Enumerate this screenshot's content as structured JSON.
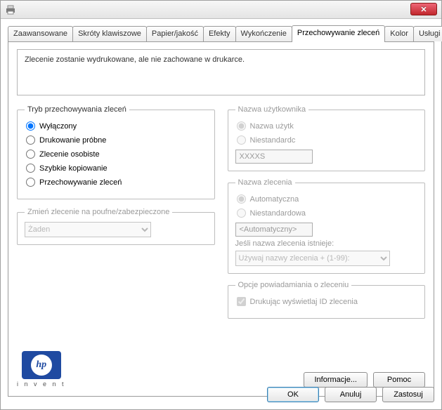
{
  "titlebar": {
    "close_glyph": "✕"
  },
  "tabs": {
    "advanced": "Zaawansowane",
    "shortcuts": "Skróty klawiszowe",
    "paper": "Papier/jakość",
    "effects": "Efekty",
    "finishing": "Wykończenie",
    "storage": "Przechowywanie zleceń",
    "color": "Kolor",
    "services": "Usługi"
  },
  "message": "Zlecenie zostanie wydrukowane, ale nie zachowane w drukarce.",
  "mode": {
    "legend": "Tryb przechowywania zleceń",
    "off": "Wyłączony",
    "proof": "Drukowanie próbne",
    "personal": "Zlecenie osobiste",
    "quickcopy": "Szybkie kopiowanie",
    "storage": "Przechowywanie zleceń"
  },
  "secure": {
    "legend": "Zmień zlecenie na poufne/zabezpieczone",
    "value": "Żaden"
  },
  "username": {
    "legend": "Nazwa użytkownika",
    "auto": "Nazwa użytk",
    "custom": "Niestandardc",
    "value": "XXXXS"
  },
  "jobname": {
    "legend": "Nazwa zlecenia",
    "auto": "Automatyczna",
    "custom": "Niestandardowa",
    "value": "<Automatyczny>",
    "exists_label": "Jeśli nazwa zlecenia istnieje:",
    "exists_value": "Używaj nazwy zlecenia + (1-99):"
  },
  "notify": {
    "legend": "Opcje powiadamiania o zleceniu",
    "show_id": "Drukując wyświetlaj ID zlecenia"
  },
  "logo": {
    "hp": "hp",
    "invent": "i n v e n t"
  },
  "panel_buttons": {
    "info": "Informacje...",
    "help": "Pomoc"
  },
  "footer": {
    "ok": "OK",
    "cancel": "Anuluj",
    "apply": "Zastosuj"
  }
}
